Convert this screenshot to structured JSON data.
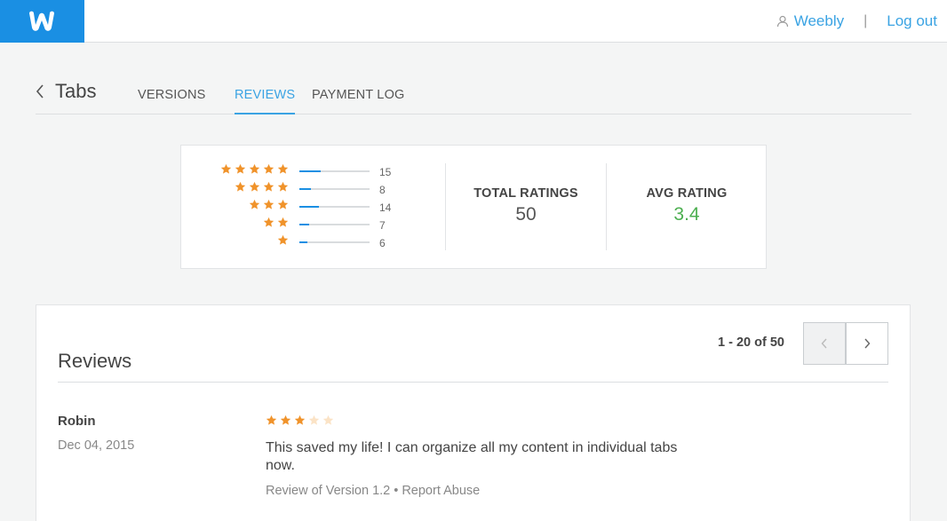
{
  "header": {
    "user_label": "Weebly",
    "separator": "|",
    "logout_label": "Log out"
  },
  "nav": {
    "back_label": "Tabs",
    "tabs": [
      {
        "label": "VERSIONS",
        "active": false
      },
      {
        "label": "REVIEWS",
        "active": true
      },
      {
        "label": "PAYMENT LOG",
        "active": false
      }
    ]
  },
  "ratings": {
    "distribution": [
      {
        "stars": 5,
        "count": "15",
        "fraction": 0.3
      },
      {
        "stars": 4,
        "count": "8",
        "fraction": 0.16
      },
      {
        "stars": 3,
        "count": "14",
        "fraction": 0.28
      },
      {
        "stars": 2,
        "count": "7",
        "fraction": 0.14
      },
      {
        "stars": 1,
        "count": "6",
        "fraction": 0.12
      }
    ],
    "total_label": "TOTAL RATINGS",
    "total_value": "50",
    "avg_label": "AVG RATING",
    "avg_value": "3.4"
  },
  "reviews": {
    "title": "Reviews",
    "pager": "1 - 20 of 50",
    "items": [
      {
        "author": "Robin",
        "date": "Dec 04, 2015",
        "rating": 3,
        "max_rating": 5,
        "text": "This saved my life! I can organize all my content in individual tabs now.",
        "version": "Review of Version 1.2",
        "meta_sep": "•",
        "report_label": "Report Abuse"
      }
    ]
  },
  "colors": {
    "brand_blue": "#1a8fe3",
    "link_blue": "#3aa3e3",
    "star_orange": "#f0932b",
    "star_empty": "#fbe3c6",
    "avg_green": "#4caf50"
  }
}
